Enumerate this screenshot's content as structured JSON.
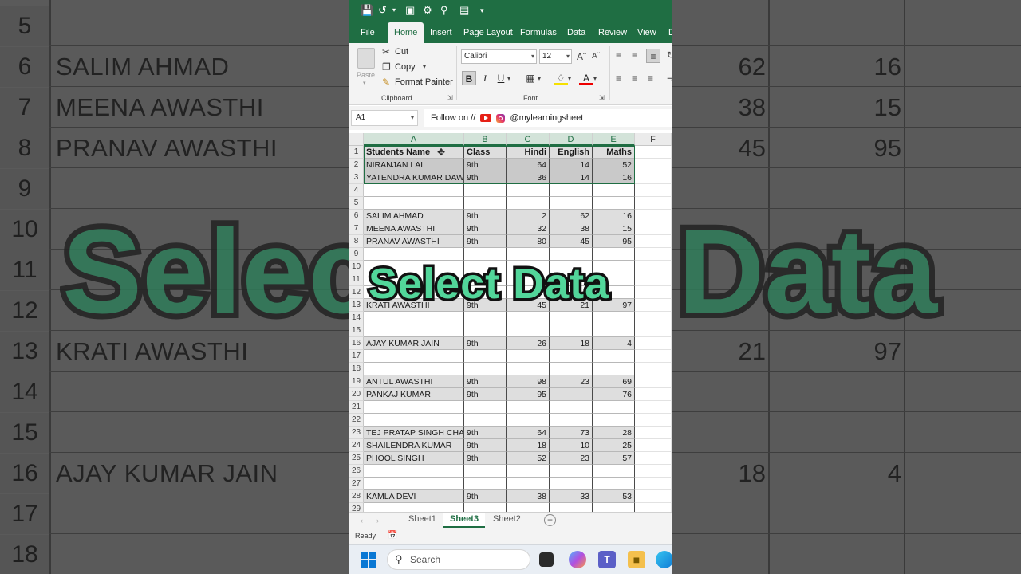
{
  "caption": "Select Data",
  "background": {
    "rows": [
      {
        "num": "5",
        "name": "",
        "v1": "",
        "v2": ""
      },
      {
        "num": "6",
        "name": "SALIM AHMAD",
        "v1": "62",
        "v2": "16"
      },
      {
        "num": "7",
        "name": "MEENA AWASTHI",
        "v1": "38",
        "v2": "15"
      },
      {
        "num": "8",
        "name": "PRANAV AWASTHI",
        "v1": "45",
        "v2": "95"
      },
      {
        "num": "9",
        "name": "",
        "v1": "",
        "v2": ""
      },
      {
        "num": "10",
        "name": "",
        "v1": "",
        "v2": ""
      },
      {
        "num": "11",
        "name": "",
        "v1": "",
        "v2": ""
      },
      {
        "num": "12",
        "name": "",
        "v1": "",
        "v2": ""
      },
      {
        "num": "13",
        "name": "KRATI AWASTHI",
        "v1": "21",
        "v2": "97"
      },
      {
        "num": "14",
        "name": "",
        "v1": "",
        "v2": ""
      },
      {
        "num": "15",
        "name": "",
        "v1": "",
        "v2": ""
      },
      {
        "num": "16",
        "name": "AJAY KUMAR JAIN",
        "v1": "18",
        "v2": "4"
      },
      {
        "num": "17",
        "name": "",
        "v1": "",
        "v2": ""
      },
      {
        "num": "18",
        "name": "",
        "v1": "",
        "v2": ""
      }
    ],
    "big_left": "Select",
    "big_right": "Data"
  },
  "quick_access": [
    "💾",
    "↶",
    "▾",
    "⎙",
    "⚙",
    "🔍",
    "▤",
    "⫶"
  ],
  "tabs": [
    "File",
    "Home",
    "Insert",
    "Page Layout",
    "Formulas",
    "Data",
    "Review",
    "View",
    "D"
  ],
  "active_tab": "Home",
  "clipboard": {
    "paste": "Paste",
    "cut": "Cut",
    "copy": "Copy",
    "format_painter": "Format Painter",
    "group_label": "Clipboard"
  },
  "font": {
    "family": "Calibri",
    "size": "12",
    "group_label": "Font"
  },
  "name_box": "A1",
  "formula_text": {
    "prefix": "Follow on //",
    "handle": "@mylearningsheet"
  },
  "columns": [
    "A",
    "B",
    "C",
    "D",
    "E",
    "F"
  ],
  "header_row": [
    "Students Name",
    "Class",
    "Hindi",
    "English",
    "Maths"
  ],
  "rows": [
    {
      "n": "1",
      "kind": "hdr"
    },
    {
      "n": "2",
      "kind": "data",
      "cells": [
        "NIRANJAN LAL",
        "9th",
        "64",
        "14",
        "52"
      ]
    },
    {
      "n": "3",
      "kind": "data",
      "cells": [
        "YATENDRA KUMAR DAW",
        "9th",
        "36",
        "14",
        "16"
      ]
    },
    {
      "n": "4",
      "kind": "blank"
    },
    {
      "n": "5",
      "kind": "blank"
    },
    {
      "n": "6",
      "kind": "data",
      "cells": [
        "SALIM AHMAD",
        "9th",
        "2",
        "62",
        "16"
      ]
    },
    {
      "n": "7",
      "kind": "data",
      "cells": [
        "MEENA AWASTHI",
        "9th",
        "32",
        "38",
        "15"
      ]
    },
    {
      "n": "8",
      "kind": "data",
      "cells": [
        "PRANAV AWASTHI",
        "9th",
        "80",
        "45",
        "95"
      ]
    },
    {
      "n": "9",
      "kind": "blank"
    },
    {
      "n": "10",
      "kind": "blank"
    },
    {
      "n": "11",
      "kind": "blank"
    },
    {
      "n": "12",
      "kind": "blank"
    },
    {
      "n": "13",
      "kind": "data",
      "cells": [
        "KRATI AWASTHI",
        "9th",
        "45",
        "21",
        "97"
      ]
    },
    {
      "n": "14",
      "kind": "blank"
    },
    {
      "n": "15",
      "kind": "blank"
    },
    {
      "n": "16",
      "kind": "data",
      "cells": [
        "AJAY KUMAR JAIN",
        "9th",
        "26",
        "18",
        "4"
      ]
    },
    {
      "n": "17",
      "kind": "blank"
    },
    {
      "n": "18",
      "kind": "blank"
    },
    {
      "n": "19",
      "kind": "data",
      "cells": [
        "ANTUL AWASTHI",
        "9th",
        "98",
        "23",
        "69"
      ]
    },
    {
      "n": "20",
      "kind": "data",
      "cells": [
        "PANKAJ KUMAR",
        "9th",
        "95",
        "",
        "76"
      ]
    },
    {
      "n": "21",
      "kind": "blank"
    },
    {
      "n": "22",
      "kind": "blank"
    },
    {
      "n": "23",
      "kind": "data",
      "cells": [
        "TEJ PRATAP SINGH CHAU",
        "9th",
        "64",
        "73",
        "28"
      ]
    },
    {
      "n": "24",
      "kind": "data",
      "cells": [
        "SHAILENDRA KUMAR",
        "9th",
        "18",
        "10",
        "25"
      ]
    },
    {
      "n": "25",
      "kind": "data",
      "cells": [
        "PHOOL SINGH",
        "9th",
        "52",
        "23",
        "57"
      ]
    },
    {
      "n": "26",
      "kind": "blank"
    },
    {
      "n": "27",
      "kind": "blank"
    },
    {
      "n": "28",
      "kind": "data",
      "cells": [
        "KAMLA DEVI",
        "9th",
        "38",
        "33",
        "53"
      ]
    },
    {
      "n": "29",
      "kind": "blank"
    }
  ],
  "sheets": [
    "Sheet1",
    "Sheet3",
    "Sheet2"
  ],
  "active_sheet": "Sheet3",
  "status": "Ready",
  "taskbar": {
    "search_placeholder": "Search"
  },
  "colors": {
    "excel_green": "#1f6e43",
    "caption_fill": "#52d69a"
  }
}
